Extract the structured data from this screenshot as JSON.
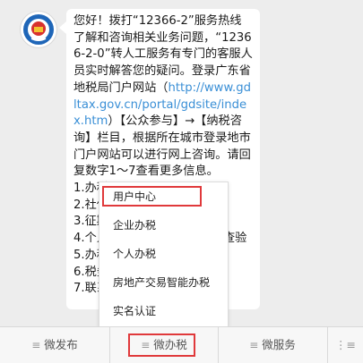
{
  "colors": {
    "highlight": "#e0393b",
    "link": "#3a8fd6",
    "badge_blue": "#1f66b8"
  },
  "chat": {
    "avatar_icon": "tax-bureau-badge-icon",
    "message": {
      "part1": "您好！拨打“12366-2”服务热线了解和咨询相关业务问题，“12366-2-0”转人工服务有专门的客服人员实时解答您的疑问。登录广东省地税局门户网站（",
      "link": "http://www.gdltax.gov.cn/portal/gdsite/index.htm",
      "part2": "）【公众参与】→【纳税咨询】栏目，根据所在城市登录地市门户网站可以进行网上咨询。请回复数字1～7查看更多信息。"
    },
    "options": [
      "1.办税",
      "2.社保",
      "3.征期",
      "4.个人",
      "5.办税",
      "6.税务",
      "7.联系"
    ],
    "option4_tail": "查验"
  },
  "popup": {
    "items": [
      "用户中心",
      "企业办税",
      "个人办税",
      "房地产交易智能办税",
      "实名认证"
    ]
  },
  "tabbar": {
    "tabs": [
      "微发布",
      "微办税",
      "微服务"
    ],
    "menu_icon": "list-menu-icon",
    "keyboard_icon": "keyboard-toggle-icon",
    "menu_glyph": "≡",
    "keyboard_glyph": "⋮≡"
  }
}
